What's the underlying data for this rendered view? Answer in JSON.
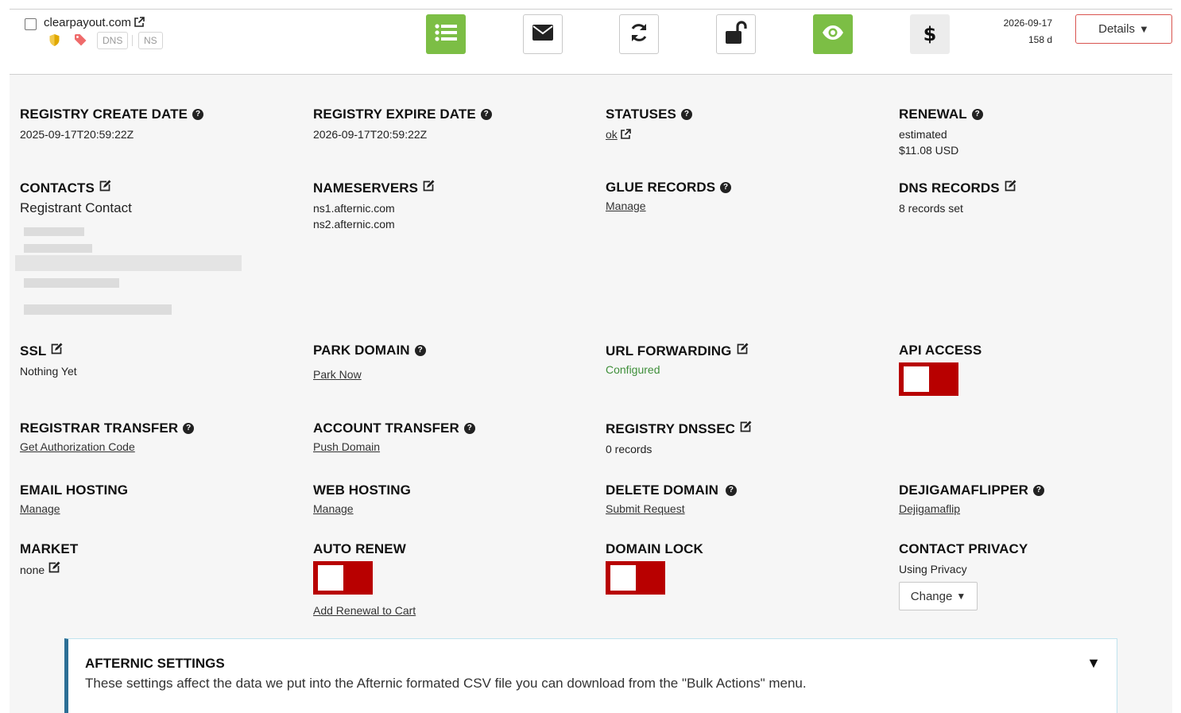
{
  "row": {
    "domain": "clearpayout.com",
    "chips": [
      "DNS",
      "NS"
    ],
    "expire_date": "2026-09-17",
    "expire_days": "158 d",
    "details_label": "Details",
    "details_caret": "▼"
  },
  "actions": [
    {
      "name": "list-button",
      "icon": "list-icon",
      "style": "green"
    },
    {
      "name": "email-button",
      "icon": "envelope-icon",
      "style": "white"
    },
    {
      "name": "refresh-button",
      "icon": "refresh-icon",
      "style": "white"
    },
    {
      "name": "lock-button",
      "icon": "unlock-icon",
      "style": "white"
    },
    {
      "name": "view-button",
      "icon": "eye-icon",
      "style": "green"
    },
    {
      "name": "price-button",
      "icon": "dollar-icon",
      "style": "gray"
    }
  ],
  "fields": {
    "registry_create": {
      "label": "REGISTRY CREATE DATE",
      "value": "2025-09-17T20:59:22Z"
    },
    "registry_expire": {
      "label": "REGISTRY EXPIRE DATE",
      "value": "2026-09-17T20:59:22Z"
    },
    "statuses": {
      "label": "STATUSES",
      "value": "ok"
    },
    "renewal": {
      "label": "RENEWAL",
      "line1": "estimated",
      "line2": "$11.08 USD"
    },
    "contacts": {
      "label": "CONTACTS",
      "value": "Registrant Contact"
    },
    "nameservers": {
      "label": "NAMESERVERS",
      "ns1": "ns1.afternic.com",
      "ns2": "ns2.afternic.com"
    },
    "glue": {
      "label": "GLUE RECORDS",
      "link": "Manage"
    },
    "dns_records": {
      "label": "DNS RECORDS",
      "value": "8 records set"
    },
    "ssl": {
      "label": "SSL",
      "value": "Nothing Yet"
    },
    "park": {
      "label": "PARK DOMAIN",
      "link": "Park Now"
    },
    "url_forwarding": {
      "label": "URL FORWARDING",
      "value": "Configured"
    },
    "api_access": {
      "label": "API ACCESS"
    },
    "registrar_transfer": {
      "label": "REGISTRAR TRANSFER",
      "link": "Get Authorization Code"
    },
    "account_transfer": {
      "label": "ACCOUNT TRANSFER",
      "link": "Push Domain"
    },
    "dnssec": {
      "label": "REGISTRY DNSSEC",
      "value": "0 records"
    },
    "email_hosting": {
      "label": "EMAIL HOSTING",
      "link": "Manage"
    },
    "web_hosting": {
      "label": "WEB HOSTING",
      "link": "Manage"
    },
    "delete_domain": {
      "label": "DELETE DOMAIN",
      "link": "Submit Request"
    },
    "dejigamaflipper": {
      "label": "DEJIGAMAFLIPPER",
      "link": "Dejigamaflip"
    },
    "market": {
      "label": "MARKET",
      "value": "none"
    },
    "auto_renew": {
      "label": "AUTO RENEW",
      "link": "Add Renewal to Cart"
    },
    "domain_lock": {
      "label": "DOMAIN LOCK"
    },
    "contact_privacy": {
      "label": "CONTACT PRIVACY",
      "value": "Using Privacy",
      "button": "Change",
      "caret": "▼"
    }
  },
  "afternic": {
    "title": "AFTERNIC SETTINGS",
    "description": "These settings affect the data we put into the Afternic formated CSV file you can download from the \"Bulk Actions\" menu.",
    "caret": "▼"
  },
  "colors": {
    "accent_green": "#7cbe45",
    "toggle_off": "#b80000",
    "details_border": "#d9534f"
  }
}
